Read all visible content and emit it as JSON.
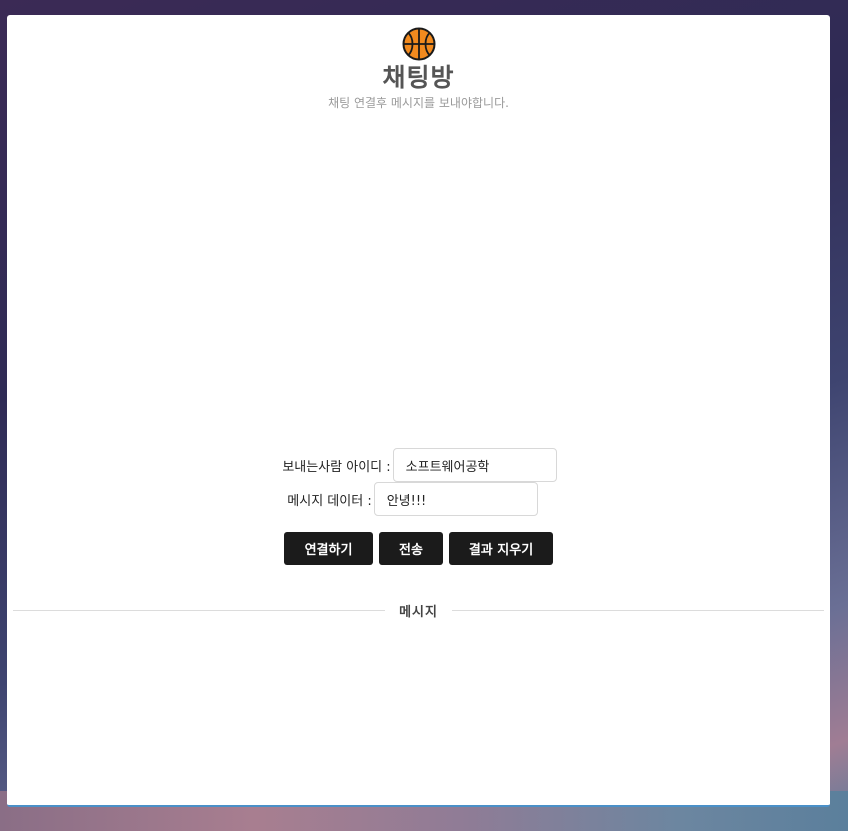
{
  "header": {
    "logo_icon": "basketball-icon",
    "title": "채팅방",
    "subtitle": "채팅 연결후 메시지를 보내야합니다."
  },
  "form": {
    "sender_label": "보내는사람 아이디 :",
    "sender_value": "소프트웨어공학",
    "message_label": "메시지 데이터 :",
    "message_value": "안녕!!!"
  },
  "buttons": {
    "connect_label": "연결하기",
    "send_label": "전송",
    "clear_label": "결과 지우기"
  },
  "messages": {
    "section_title": "메시지",
    "items": []
  },
  "colors": {
    "button_bg": "#1b1b1b",
    "title_text": "#555555",
    "card_bottom_border": "#4a90c8"
  }
}
